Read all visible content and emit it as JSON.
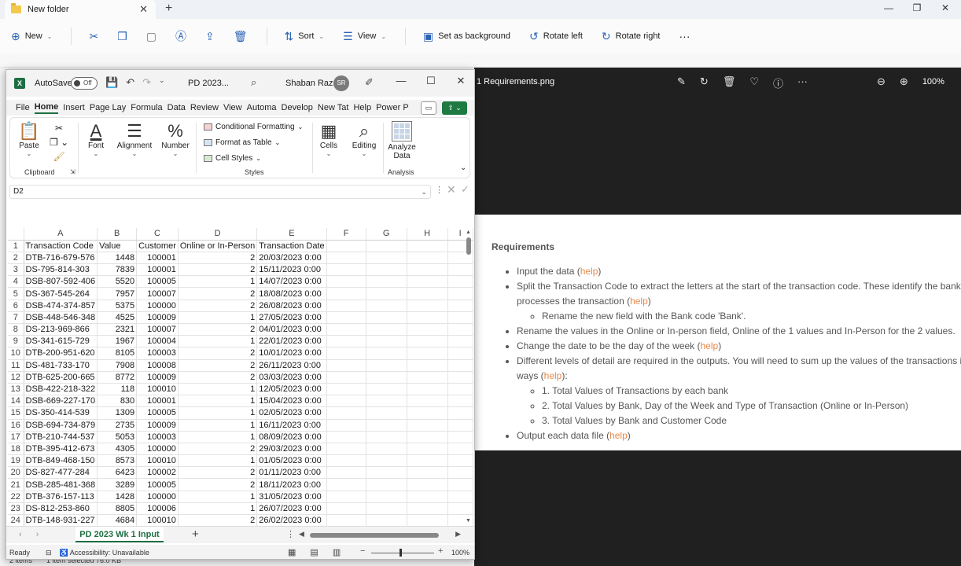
{
  "explorer": {
    "tab_title": "New folder",
    "toolbar": {
      "new": "New",
      "sort": "Sort",
      "view": "View",
      "set_background": "Set as background",
      "rotate_left": "Rotate left",
      "rotate_right": "Rotate right"
    },
    "status": {
      "items": "2 items",
      "selected": "1 item selected  76.0 KB"
    }
  },
  "viewer": {
    "filename": "1 Requirements.png",
    "zoom": "100%",
    "doc": {
      "heading": "Requirements",
      "b1a": "Input the data (",
      "b2a": "Split the Transaction Code to extract the letters at the start of the transaction code. These identify the bank",
      "b2b": "processes the transaction (",
      "b2sub": "Rename the new field with the Bank code 'Bank'.",
      "b3": "Rename the values in the Online or In-person field, Online of the 1 values and In-Person for the 2 values.",
      "b4a": "Change the date to be the day of the week (",
      "b5a": "Different levels of detail are required in the outputs. You will need to sum up the values of the transactions i",
      "b5b": "ways (",
      "b5s1": "1. Total Values of Transactions by each bank",
      "b5s2": "2. Total Values by Bank, Day of the Week and Type of Transaction (Online or In-Person)",
      "b5s3": "3. Total Values by Bank and Customer Code",
      "b6a": "Output each data file (",
      "help": "help",
      "close_paren": ")",
      "close_paren_colon": "):"
    }
  },
  "excel": {
    "autosave": "AutoSave",
    "toggle": "Off",
    "doc_name": "PD 2023...",
    "user": "Shaban Raza",
    "initials": "SR",
    "menu": [
      "File",
      "Home",
      "Insert",
      "Page Lay",
      "Formula",
      "Data",
      "Review",
      "View",
      "Automa",
      "Develop",
      "New Tat",
      "Help",
      "Power P"
    ],
    "ribbon": {
      "paste": "Paste",
      "clipboard": "Clipboard",
      "font": "Font",
      "alignment": "Alignment",
      "number": "Number",
      "cond_format": "Conditional Formatting",
      "format_table": "Format as Table",
      "cell_styles": "Cell Styles",
      "styles": "Styles",
      "cells": "Cells",
      "editing": "Editing",
      "analyze_data_1": "Analyze",
      "analyze_data_2": "Data",
      "analysis": "Analysis"
    },
    "name_box": "D2",
    "columns": [
      "A",
      "B",
      "C",
      "D",
      "E",
      "F",
      "G",
      "H",
      "I"
    ],
    "rows": [
      [
        "1",
        "Transaction Code",
        "Value",
        "Customer",
        "Online or In-Person",
        "Transaction Date"
      ],
      [
        "2",
        "DTB-716-679-576",
        "1448",
        "100001",
        "2",
        "20/03/2023 0:00"
      ],
      [
        "3",
        "DS-795-814-303",
        "7839",
        "100001",
        "2",
        "15/11/2023 0:00"
      ],
      [
        "4",
        "DSB-807-592-406",
        "5520",
        "100005",
        "1",
        "14/07/2023 0:00"
      ],
      [
        "5",
        "DS-367-545-264",
        "7957",
        "100007",
        "2",
        "18/08/2023 0:00"
      ],
      [
        "6",
        "DSB-474-374-857",
        "5375",
        "100000",
        "2",
        "26/08/2023 0:00"
      ],
      [
        "7",
        "DSB-448-546-348",
        "4525",
        "100009",
        "1",
        "27/05/2023 0:00"
      ],
      [
        "8",
        "DS-213-969-866",
        "2321",
        "100007",
        "2",
        "04/01/2023 0:00"
      ],
      [
        "9",
        "DS-341-615-729",
        "1967",
        "100004",
        "1",
        "22/01/2023 0:00"
      ],
      [
        "10",
        "DTB-200-951-620",
        "8105",
        "100003",
        "2",
        "10/01/2023 0:00"
      ],
      [
        "11",
        "DS-481-733-170",
        "7908",
        "100008",
        "2",
        "26/11/2023 0:00"
      ],
      [
        "12",
        "DTB-625-200-665",
        "8772",
        "100009",
        "2",
        "03/03/2023 0:00"
      ],
      [
        "13",
        "DSB-422-218-322",
        "118",
        "100010",
        "1",
        "12/05/2023 0:00"
      ],
      [
        "14",
        "DSB-669-227-170",
        "830",
        "100001",
        "1",
        "15/04/2023 0:00"
      ],
      [
        "15",
        "DS-350-414-539",
        "1309",
        "100005",
        "1",
        "02/05/2023 0:00"
      ],
      [
        "16",
        "DSB-694-734-879",
        "2735",
        "100009",
        "1",
        "16/11/2023 0:00"
      ],
      [
        "17",
        "DTB-210-744-537",
        "5053",
        "100003",
        "1",
        "08/09/2023 0:00"
      ],
      [
        "18",
        "DTB-395-412-673",
        "4305",
        "100000",
        "2",
        "29/03/2023 0:00"
      ],
      [
        "19",
        "DTB-849-468-150",
        "8573",
        "100010",
        "1",
        "01/05/2023 0:00"
      ],
      [
        "20",
        "DS-827-477-284",
        "6423",
        "100002",
        "2",
        "01/11/2023 0:00"
      ],
      [
        "21",
        "DSB-285-481-368",
        "3289",
        "100005",
        "2",
        "18/11/2023 0:00"
      ],
      [
        "22",
        "DTB-376-157-113",
        "1428",
        "100000",
        "1",
        "31/05/2023 0:00"
      ],
      [
        "23",
        "DS-812-253-860",
        "8805",
        "100006",
        "1",
        "26/07/2023 0:00"
      ],
      [
        "24",
        "DTB-148-931-227",
        "4684",
        "100010",
        "2",
        "26/02/2023 0:00"
      ]
    ],
    "sheet_tab": "PD 2023 Wk 1 Input",
    "status": {
      "ready": "Ready",
      "accessibility": "Accessibility: Unavailable",
      "zoom": "100%"
    }
  },
  "colors": {
    "excel_green": "#1d6f42",
    "link_orange": "#e7894b",
    "viewer_bg": "#202020"
  },
  "icons": [
    "folder-icon",
    "cut-icon",
    "copy-icon",
    "paste-icon",
    "rename-icon",
    "share-icon",
    "delete-icon",
    "sort-icon",
    "view-icon",
    "background-icon",
    "rotate-left-icon",
    "rotate-right-icon",
    "more-icon",
    "excel-logo-icon",
    "save-icon",
    "undo-icon",
    "redo-icon",
    "search-icon",
    "pen-icon",
    "edit-image-icon",
    "favorite-icon",
    "info-icon",
    "zoom-in-icon",
    "zoom-out-icon"
  ]
}
